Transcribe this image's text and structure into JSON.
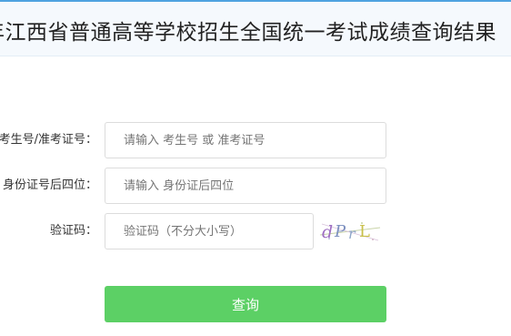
{
  "header": {
    "title": "年江西省普通高等学校招生全国统一考试成绩查询结果"
  },
  "form": {
    "exam_id": {
      "label": "考生号/准考证号：",
      "placeholder": "请输入 考生号 或 准考证号",
      "value": ""
    },
    "id_last4": {
      "label": "身份证号后四位：",
      "placeholder": "请输入 身份证后四位",
      "value": ""
    },
    "captcha": {
      "label": "验证码：",
      "placeholder": "验证码（不分大小写）",
      "value": "",
      "image_text": "dPrL"
    },
    "submit_label": "查询"
  },
  "colors": {
    "header_border": "#4fa3e0",
    "header_background": "#f5f9fd",
    "submit_background": "#5cd065"
  }
}
